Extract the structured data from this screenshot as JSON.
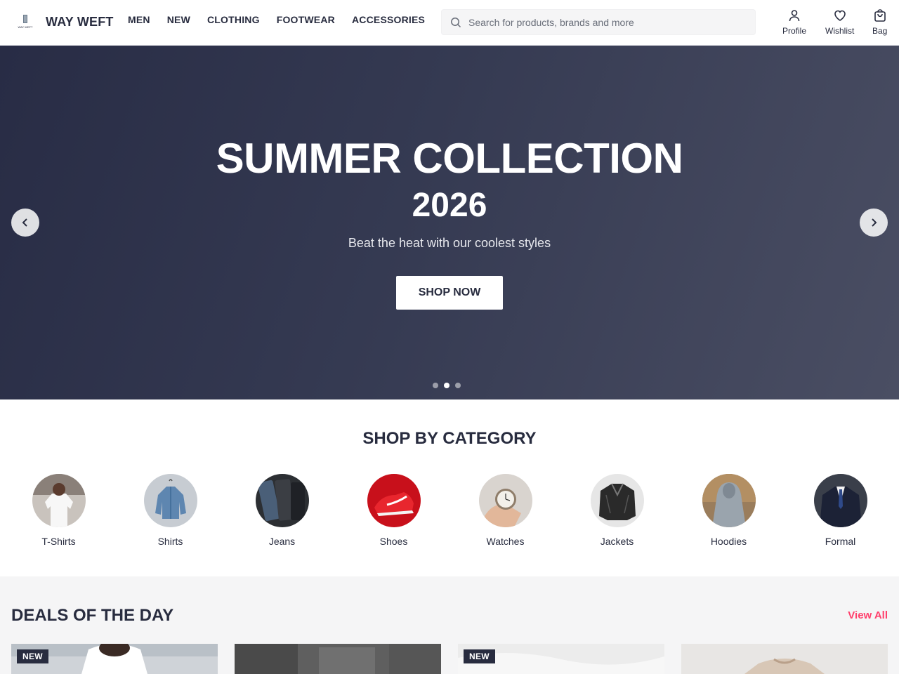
{
  "header": {
    "brand": "WAY WEFT",
    "logo_text": "WAY WEFT",
    "nav": [
      "MEN",
      "NEW",
      "CLOTHING",
      "FOOTWEAR",
      "ACCESSORIES"
    ],
    "search_placeholder": "Search for products, brands and more",
    "actions": {
      "profile": "Profile",
      "wishlist": "Wishlist",
      "bag": "Bag"
    }
  },
  "hero": {
    "title": "SUMMER COLLECTION",
    "year": "2026",
    "subtitle": "Beat the heat with our coolest styles",
    "cta": "SHOP NOW",
    "active_slide": 2,
    "slide_count": 3
  },
  "categories": {
    "title": "SHOP BY CATEGORY",
    "items": [
      "T-Shirts",
      "Shirts",
      "Jeans",
      "Shoes",
      "Watches",
      "Jackets",
      "Hoodies",
      "Formal"
    ]
  },
  "deals": {
    "title": "DEALS OF THE DAY",
    "view_all": "View All",
    "badges": [
      "NEW",
      "NEW"
    ]
  },
  "colors": {
    "accent": "#ff3f6c",
    "text": "#282c3f",
    "hero_bg": "#353a52"
  }
}
